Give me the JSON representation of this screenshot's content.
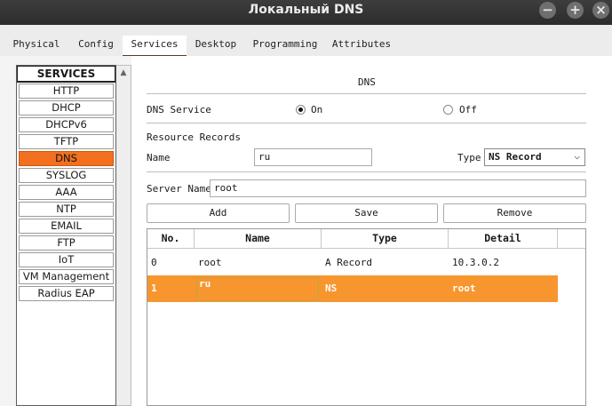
{
  "window": {
    "title": "Локальный DNS",
    "controls": [
      "minimize-icon",
      "maximize-icon",
      "close-icon"
    ]
  },
  "tabs": [
    {
      "label": "Physical",
      "active": false
    },
    {
      "label": "Config",
      "active": false
    },
    {
      "label": "Services",
      "active": true
    },
    {
      "label": "Desktop",
      "active": false
    },
    {
      "label": "Programming",
      "active": false
    },
    {
      "label": "Attributes",
      "active": false
    }
  ],
  "sidebar": {
    "header": "SERVICES",
    "items": [
      {
        "label": "HTTP"
      },
      {
        "label": "DHCP"
      },
      {
        "label": "DHCPv6"
      },
      {
        "label": "TFTP"
      },
      {
        "label": "DNS",
        "selected": true
      },
      {
        "label": "SYSLOG"
      },
      {
        "label": "AAA"
      },
      {
        "label": "NTP"
      },
      {
        "label": "EMAIL"
      },
      {
        "label": "FTP"
      },
      {
        "label": "IoT"
      },
      {
        "label": "VM Management"
      },
      {
        "label": "Radius EAP"
      }
    ]
  },
  "dns": {
    "section_title": "DNS",
    "service_label": "DNS Service",
    "on_label": "On",
    "off_label": "Off",
    "service_state": "On",
    "records_title": "Resource Records",
    "name_label": "Name",
    "name_value": "ru",
    "type_label": "Type",
    "type_value": "NS Record",
    "server_name_label": "Server Name",
    "server_name_value": "root",
    "buttons": {
      "add": "Add",
      "save": "Save",
      "remove": "Remove"
    },
    "table": {
      "columns": [
        "No.",
        "Name",
        "Type",
        "Detail"
      ],
      "rows": [
        {
          "no": "0",
          "name": "root",
          "type": "A Record",
          "detail": "10.3.0.2",
          "selected": false
        },
        {
          "no": "1",
          "name": "ru",
          "type": "NS",
          "detail": "root",
          "selected": true
        }
      ]
    }
  },
  "colors": {
    "selected_sidebar": "#f2701f",
    "selected_row": "#f7962f",
    "titlebar": "#2f2f2f"
  }
}
